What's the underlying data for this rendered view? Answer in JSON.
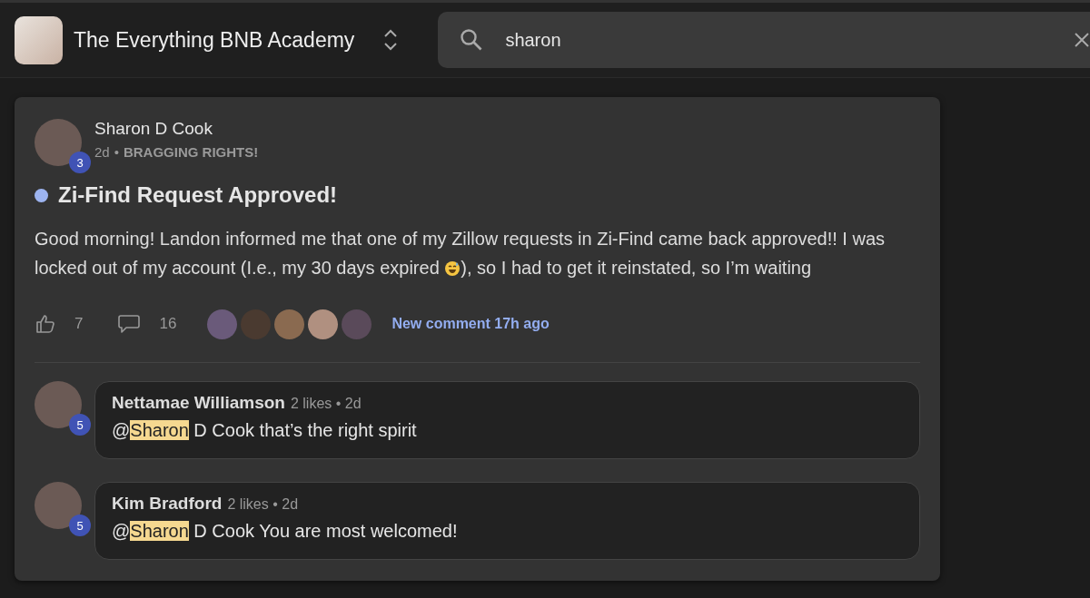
{
  "header": {
    "community": "The Everything BNB Academy",
    "search": {
      "value": "sharon"
    }
  },
  "post": {
    "author": "Sharon D Cook",
    "level": "3",
    "age": "2d",
    "separator": "•",
    "category": "BRAGGING RIGHTS!",
    "unread": true,
    "title": "Zi-Find Request Approved!",
    "body": [
      {
        "kind": "text",
        "text": "Good morning! Landon informed me that one of my Zillow requests in Zi-Find came back approved!! I was locked out of my account (I.e., my 30 days expired "
      },
      {
        "kind": "emoji"
      },
      {
        "kind": "text",
        "text": "), so I had to get it reinstated, so I’m waiting"
      }
    ],
    "likes": "7",
    "comments": "16",
    "new_comment": "New comment 17h ago"
  },
  "comments": [
    {
      "author": "Nettamae Williamson",
      "level": "5",
      "meta": "2 likes • 2d",
      "body": [
        {
          "text": "@",
          "highlighted": false
        },
        {
          "text": "Sharon",
          "highlighted": true
        },
        {
          "text": " D Cook that’s the right spirit",
          "highlighted": false
        }
      ]
    },
    {
      "author": "Kim Bradford",
      "level": "5",
      "meta": "2 likes • 2d",
      "body": [
        {
          "text": "@",
          "highlighted": false
        },
        {
          "text": "Sharon",
          "highlighted": true
        },
        {
          "text": " D Cook You are most welcomed!",
          "highlighted": false
        }
      ]
    }
  ]
}
